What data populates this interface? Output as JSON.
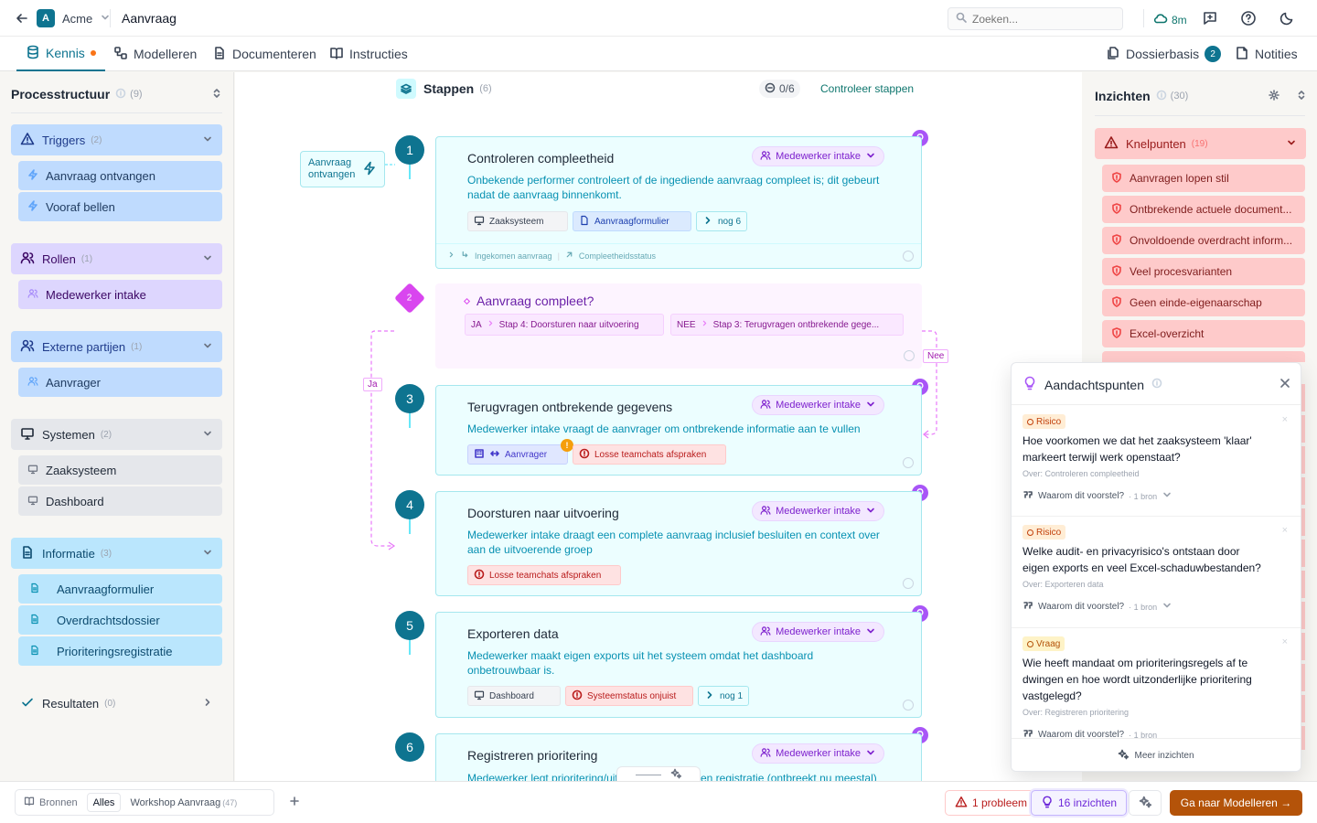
{
  "topbar": {
    "back_icon": "arrow-left-icon",
    "org_initial": "A",
    "org_name": "Acme",
    "page_title": "Aanvraag",
    "search_placeholder": "Zoeken...",
    "sync_label": "8m",
    "accent": "#0e7490"
  },
  "nav": {
    "tabs": [
      {
        "label": "Kennis"
      },
      {
        "label": "Modelleren"
      },
      {
        "label": "Documenteren"
      },
      {
        "label": "Instructies"
      }
    ],
    "dossier_label": "Dossierbasis",
    "dossier_count": "2",
    "notes_label": "Notities"
  },
  "left": {
    "title": "Processtructuur",
    "count": "(9)",
    "groups": [
      {
        "label": "Triggers",
        "count": "(2)",
        "items": [
          "Aanvraag ontvangen",
          "Vooraf bellen"
        ]
      },
      {
        "label": "Rollen",
        "count": "(1)",
        "items": [
          "Medewerker intake"
        ]
      },
      {
        "label": "Externe partijen",
        "count": "(1)",
        "items": [
          "Aanvrager"
        ]
      },
      {
        "label": "Systemen",
        "count": "(2)",
        "items": [
          "Zaaksysteem",
          "Dashboard"
        ]
      },
      {
        "label": "Informatie",
        "count": "(3)",
        "items": [
          "Aanvraagformulier",
          "Overdrachtsdossier",
          "Prioriteringsregistratie"
        ]
      }
    ],
    "results_label": "Resultaten",
    "results_count": "(0)"
  },
  "center": {
    "title": "Stappen",
    "count": "(6)",
    "progress": "0/6",
    "check_label": "Controleer stappen",
    "trigger_label": "Aanvraag ontvangen",
    "yes_label": "Ja",
    "no_label": "Nee",
    "steps": [
      {
        "num": "1",
        "title": "Controleren compleetheid",
        "role": "Medewerker intake",
        "desc": "Onbekende performer controleert of de ingediende aanvraag compleet is; dit gebeurt nadat de aanvraag binnenkomt.",
        "chips": [
          "Zaaksysteem",
          "Aanvraagformulier",
          "nog 6"
        ],
        "flow_in": "Ingekomen aanvraag",
        "flow_out": "Compleetheidsstatus"
      },
      {
        "num": "2",
        "title": "Aanvraag compleet?",
        "yes_tag": "JA",
        "yes_target": "Stap 4: Doorsturen naar uitvoering",
        "no_tag": "NEE",
        "no_target": "Stap 3: Terugvragen ontbrekende gege..."
      },
      {
        "num": "3",
        "title": "Terugvragen ontbrekende gegevens",
        "role": "Medewerker intake",
        "desc": "Medewerker intake vraagt de aanvrager om ontbrekende informatie aan te vullen",
        "chips": [
          "Aanvrager",
          "Losse teamchats afspraken"
        ],
        "warn": "!"
      },
      {
        "num": "4",
        "title": "Doorsturen naar uitvoering",
        "role": "Medewerker intake",
        "desc": "Medewerker intake draagt een complete aanvraag inclusief besluiten en context over aan de uitvoerende groep",
        "chips": [
          "Losse teamchats afspraken"
        ]
      },
      {
        "num": "5",
        "title": "Exporteren data",
        "role": "Medewerker intake",
        "desc": "Medewerker maakt eigen exports uit het systeem omdat het dashboard onbetrouwbaar is.",
        "chips": [
          "Dashboard",
          "Systeemstatus onjuist",
          "nog 1"
        ]
      },
      {
        "num": "6",
        "title": "Registreren prioritering",
        "role": "Medewerker intake",
        "desc": "Medewerker legt prioritering/uit",
        "desc_tail": "en registratie (ontbreekt nu meestal)"
      }
    ]
  },
  "right": {
    "title": "Inzichten",
    "count": "(30)",
    "group_label": "Knelpunten",
    "group_count": "(19)",
    "items": [
      "Aanvragen lopen stil",
      "Ontbrekende actuele document...",
      "Onvoldoende overdracht inform...",
      "Veel procesvarianten",
      "Geen einde-eigenaarschap",
      "Excel-overzicht"
    ]
  },
  "popover": {
    "title": "Aandachtspunten",
    "items": [
      {
        "badge": "Risico",
        "question": "Hoe voorkomen we dat het zaaksysteem 'klaar' markeert terwijl werk openstaat?",
        "over": "Over: Controleren compleetheid",
        "why": "Waarom dit voorstel?",
        "source": "· 1 bron"
      },
      {
        "badge": "Risico",
        "question": "Welke audit- en privacyrisico's ontstaan door eigen exports en veel Excel-schaduwbestanden?",
        "over": "Over: Exporteren data",
        "why": "Waarom dit voorstel?",
        "source": "· 1 bron"
      },
      {
        "badge": "Vraag",
        "question": "Wie heeft mandaat om prioriteringsregels af te dwingen en hoe wordt uitzonderlijke prioritering vastgelegd?",
        "over": "Over: Registreren prioritering",
        "why": "Waarom dit voorstel?",
        "source": "· 1 bron"
      }
    ],
    "more_label": "Meer inzichten"
  },
  "bottom": {
    "sources_label": "Bronnen",
    "all_label": "Alles",
    "workshop_label": "Workshop Aanvraag",
    "workshop_count": "(47)",
    "add_icon": "plus-icon",
    "problem_label": "1 probleem",
    "insights_label": "16 inzichten",
    "cta_label": "Ga naar Modelleren →"
  }
}
